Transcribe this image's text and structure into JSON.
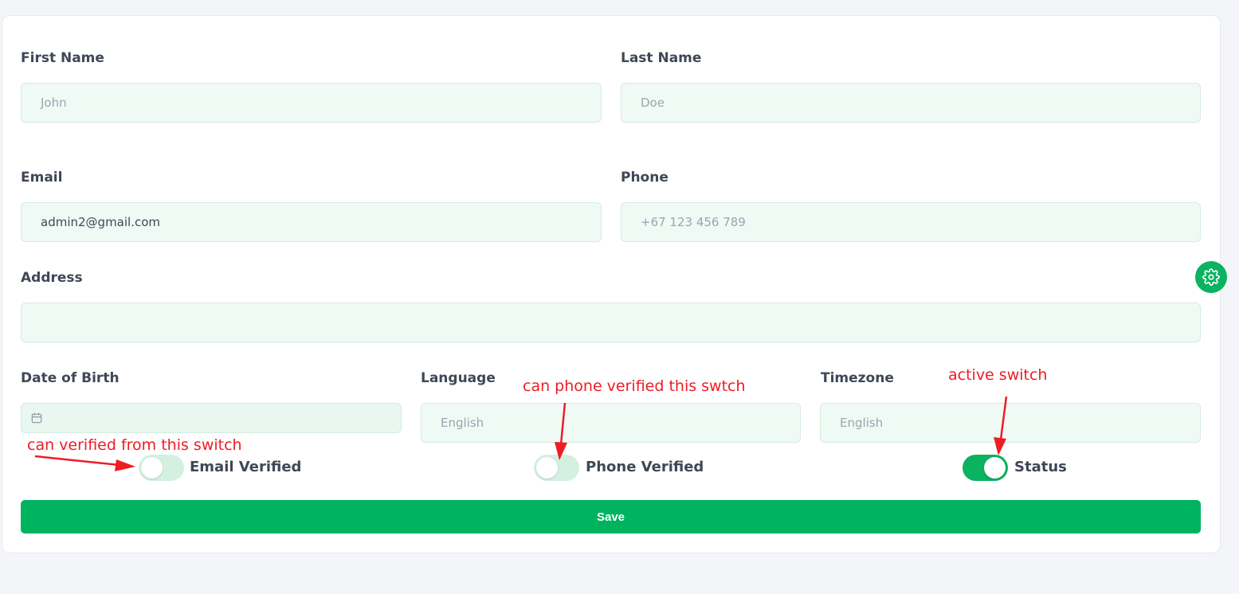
{
  "form": {
    "first_name": {
      "label": "First Name",
      "placeholder": "John"
    },
    "last_name": {
      "label": "Last Name",
      "placeholder": "Doe"
    },
    "email": {
      "label": "Email",
      "value": "admin2@gmail.com"
    },
    "phone": {
      "label": "Phone",
      "placeholder": "+67 123 456 789"
    },
    "address": {
      "label": "Address",
      "value": ""
    },
    "date_of_birth": {
      "label": "Date of Birth",
      "value": ""
    },
    "language": {
      "label": "Language",
      "placeholder": "English"
    },
    "timezone": {
      "label": "Timezone",
      "placeholder": "English"
    },
    "toggles": {
      "email_verified": {
        "label": "Email Verified",
        "on": false
      },
      "phone_verified": {
        "label": "Phone Verified",
        "on": false
      },
      "status": {
        "label": "Status",
        "on": true
      }
    },
    "save_label": "Save"
  },
  "settings_button": {
    "icon": "gear-icon"
  },
  "annotations": {
    "email_switch_note": "can verified from this switch",
    "phone_switch_note": "can phone verified this swtch",
    "status_switch_note": "active switch",
    "color": "#ee1c24"
  },
  "colors": {
    "accent": "#00b35e",
    "input_bg": "#f0faf5",
    "toggle_off": "#d3f0e1"
  }
}
